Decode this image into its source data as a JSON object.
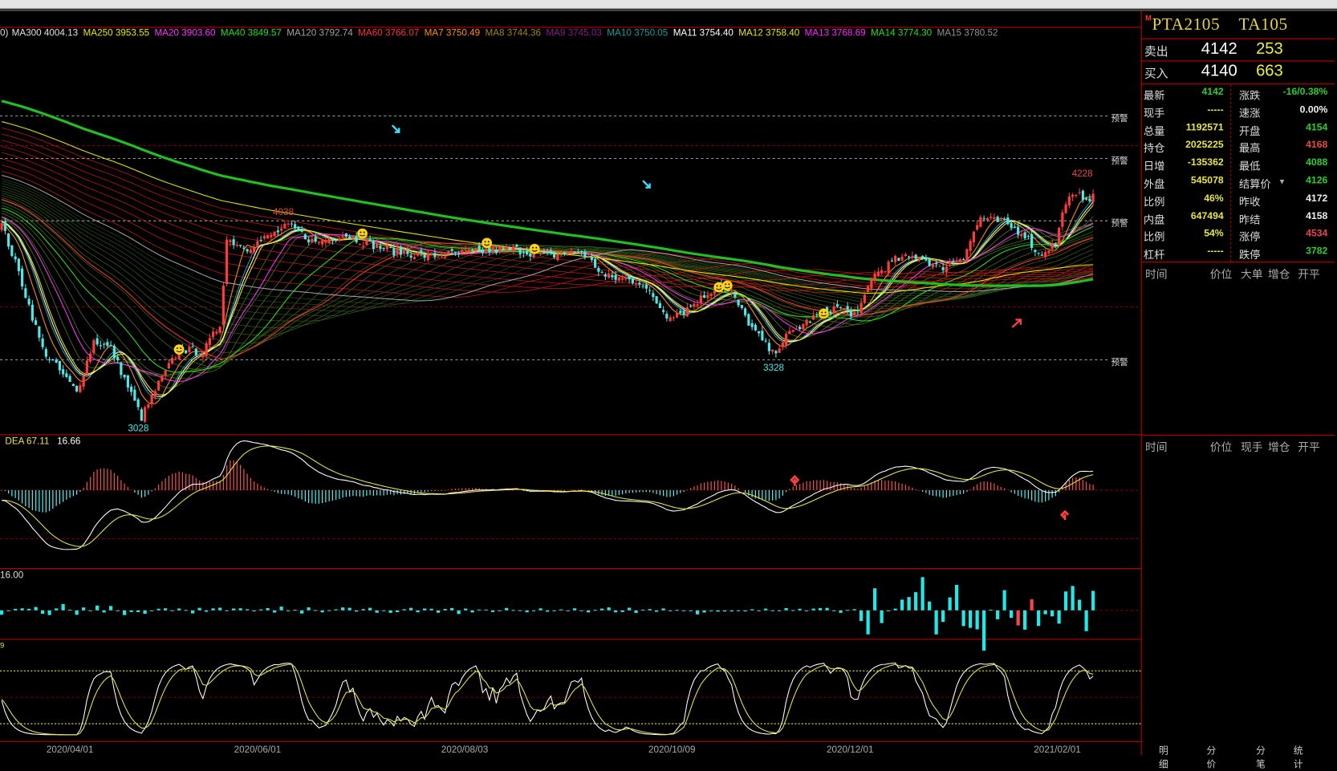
{
  "main_legend": {
    "prefix": "0)",
    "items": [
      {
        "label": "MA300 4004.13",
        "color": "#e0e0e0"
      },
      {
        "label": "MA250 3953.55",
        "color": "#e6e600"
      },
      {
        "label": "MA20 3903.60",
        "color": "#ff33ff"
      },
      {
        "label": "MA40 3849.57",
        "color": "#22dd22"
      },
      {
        "label": "MA120 3792.74",
        "color": "#a0a0a0"
      },
      {
        "label": "MA60 3766.07",
        "color": "#ff3333"
      },
      {
        "label": "MA7 3750.49",
        "color": "#ff8c1a"
      },
      {
        "label": "MA8 3744.36",
        "color": "#a08020"
      },
      {
        "label": "MA9 3745.03",
        "color": "#8a168a"
      },
      {
        "label": "MA10 3750.05",
        "color": "#1a9a9a"
      },
      {
        "label": "MA11 3754.40",
        "color": "#ffffff"
      },
      {
        "label": "MA12 3758.40",
        "color": "#e6e600"
      },
      {
        "label": "MA13 3768.69",
        "color": "#ff22ff"
      },
      {
        "label": "MA14 3774.30",
        "color": "#22dd22"
      },
      {
        "label": "MA15 3780.52",
        "color": "#909090"
      }
    ]
  },
  "macd_legend": {
    "dea": "DEA 67.11",
    "value": "16.66"
  },
  "vol_legend": "16.00",
  "kdj_legend": "9",
  "alert_label": "预警",
  "price_marks": {
    "high_left": "4038",
    "low_left": "3028",
    "low_mid": "3328",
    "high_right": "4228"
  },
  "dates": [
    "2020/04/01",
    "2020/06/01",
    "2020/08/03",
    "2020/10/09",
    "2020/12/01",
    "2021/02/01"
  ],
  "quote": {
    "badge": "M",
    "symbol": "PTA2105",
    "code": "TA105",
    "sell": {
      "label": "卖出",
      "price": "4142",
      "qty": "253"
    },
    "buy": {
      "label": "买入",
      "price": "4140",
      "qty": "663"
    },
    "rows": [
      {
        "l": "最新",
        "v": "4142",
        "vc": "#2ecc2e",
        "r": "涨跌",
        "rv": "-16/0.38%",
        "rc": "#2ecc2e"
      },
      {
        "l": "现手",
        "v": "-----",
        "vc": "#e6e64a",
        "r": "速涨",
        "rv": "0.00%",
        "rc": "#eeeeee"
      },
      {
        "l": "总量",
        "v": "1192571",
        "vc": "#e6e64a",
        "r": "开盘",
        "rv": "4154",
        "rc": "#2ecc2e"
      },
      {
        "l": "持仓",
        "v": "2025225",
        "vc": "#e6e64a",
        "r": "最高",
        "rv": "4168",
        "rc": "#e84848"
      },
      {
        "l": "日增",
        "v": "-135362",
        "vc": "#e6e64a",
        "r": "最低",
        "rv": "4088",
        "rc": "#2ecc2e"
      },
      {
        "l": "外盘",
        "v": "545078",
        "vc": "#e6e64a",
        "r": "结算价",
        "rv": "4126",
        "rc": "#2ecc2e"
      },
      {
        "l": "比例",
        "v": "46%",
        "vc": "#e6e64a",
        "r": "昨收",
        "rv": "4172",
        "rc": "#eeeeee"
      },
      {
        "l": "内盘",
        "v": "647494",
        "vc": "#e6e64a",
        "r": "昨结",
        "rv": "4158",
        "rc": "#eeeeee"
      },
      {
        "l": "比例",
        "v": "54%",
        "vc": "#e6e64a",
        "r": "涨停",
        "rv": "4534",
        "rc": "#e84848"
      },
      {
        "l": "杠杆",
        "v": "-----",
        "vc": "#e6e64a",
        "r": "跌停",
        "rv": "3782",
        "rc": "#2ecc2e"
      }
    ]
  },
  "tick_header_1": [
    "时间",
    "价位",
    "大单",
    "增仓",
    "开平"
  ],
  "tick_header_2": [
    "时间",
    "价位",
    "现手",
    "增仓",
    "开平"
  ],
  "tabs": [
    "明细",
    "分价",
    "分笔",
    "统计"
  ],
  "chart_data": {
    "type": "candlestick",
    "symbol": "PTA2105",
    "x_ticks": [
      "2020/04/01",
      "2020/06/01",
      "2020/08/03",
      "2020/10/09",
      "2020/12/01",
      "2021/02/01"
    ],
    "close_key_points": [
      [
        0,
        3990
      ],
      [
        5,
        3760
      ],
      [
        12,
        3395
      ],
      [
        22,
        3190
      ],
      [
        27,
        3435
      ],
      [
        32,
        3400
      ],
      [
        41,
        3070
      ],
      [
        46,
        3230
      ],
      [
        52,
        3395
      ],
      [
        59,
        3380
      ],
      [
        64,
        3515
      ],
      [
        66,
        3920
      ],
      [
        72,
        3880
      ],
      [
        84,
        3984
      ],
      [
        92,
        3903
      ],
      [
        100,
        3945
      ],
      [
        107,
        3903
      ],
      [
        115,
        3862
      ],
      [
        125,
        3840
      ],
      [
        140,
        3862
      ],
      [
        150,
        3874
      ],
      [
        160,
        3840
      ],
      [
        170,
        3862
      ],
      [
        177,
        3740
      ],
      [
        187,
        3720
      ],
      [
        195,
        3557
      ],
      [
        200,
        3577
      ],
      [
        210,
        3699
      ],
      [
        214,
        3659
      ],
      [
        220,
        3496
      ],
      [
        226,
        3374
      ],
      [
        230,
        3455
      ],
      [
        237,
        3537
      ],
      [
        245,
        3598
      ],
      [
        251,
        3557
      ],
      [
        255,
        3740
      ],
      [
        262,
        3822
      ],
      [
        269,
        3842
      ],
      [
        275,
        3780
      ],
      [
        282,
        3842
      ],
      [
        287,
        4024
      ],
      [
        294,
        3995
      ],
      [
        300,
        3943
      ],
      [
        304,
        3846
      ],
      [
        309,
        3903
      ],
      [
        312,
        4106
      ],
      [
        316,
        4126
      ],
      [
        320,
        4118
      ]
    ],
    "annotated_extremes": [
      {
        "label": "4038",
        "price": 4038
      },
      {
        "label": "3028",
        "price": 3028
      },
      {
        "label": "3328",
        "price": 3328
      },
      {
        "label": "4228",
        "price": 4228
      }
    ],
    "ma_periods": [
      7,
      8,
      9,
      10,
      11,
      12,
      13,
      14,
      15,
      20,
      40,
      60,
      120,
      250,
      300
    ],
    "indicators": [
      "MACD",
      "VOL-diff",
      "KDJ"
    ],
    "up_color": "#ff3b3b",
    "down_color": "#4de8e8"
  }
}
